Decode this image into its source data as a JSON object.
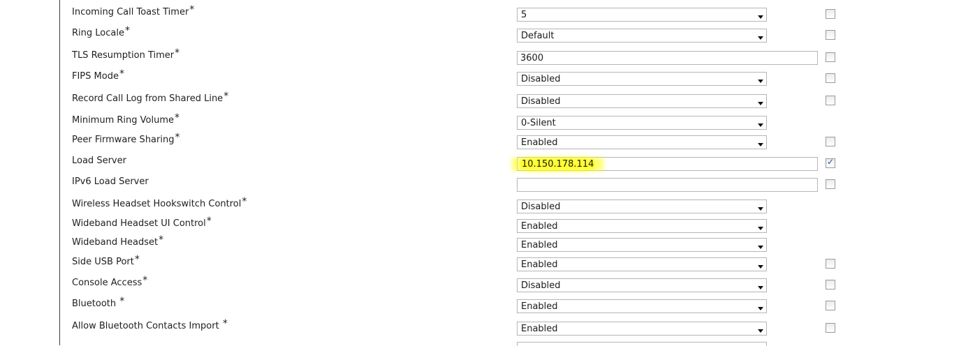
{
  "rows": [
    {
      "label": "Incoming Call Toast Timer",
      "required": "*",
      "control": "select",
      "value": "5",
      "checkbox": true,
      "checked": false
    },
    {
      "label": "Ring Locale",
      "required": "*",
      "control": "select",
      "value": "Default",
      "checkbox": true,
      "checked": false
    },
    {
      "label": "TLS Resumption Timer",
      "required": "*",
      "control": "text",
      "value": "3600",
      "checkbox": true,
      "checked": false
    },
    {
      "label": "FIPS Mode",
      "required": "*",
      "control": "select",
      "value": "Disabled",
      "checkbox": true,
      "checked": false
    },
    {
      "label": "Record Call Log from Shared Line",
      "required": "*",
      "control": "select",
      "value": "Disabled",
      "checkbox": true,
      "checked": false
    },
    {
      "label": "Minimum Ring Volume",
      "required": "*",
      "control": "select",
      "value": "0-Silent",
      "checkbox": false,
      "checked": false
    },
    {
      "label": "Peer Firmware Sharing",
      "required": "*",
      "control": "select",
      "value": "Enabled",
      "checkbox": true,
      "checked": false
    },
    {
      "label": "Load Server",
      "required": "",
      "control": "text",
      "value": "10.150.178.114",
      "checkbox": true,
      "checked": true,
      "highlight": true
    },
    {
      "label": "IPv6 Load Server",
      "required": "",
      "control": "text",
      "value": "",
      "checkbox": true,
      "checked": false
    },
    {
      "label": "Wireless Headset Hookswitch Control",
      "required": "*",
      "control": "select",
      "value": "Disabled",
      "checkbox": false,
      "checked": false
    },
    {
      "label": "Wideband Headset UI Control",
      "required": "*",
      "control": "select",
      "value": "Enabled",
      "checkbox": false,
      "checked": false
    },
    {
      "label": "Wideband Headset",
      "required": "*",
      "control": "select",
      "value": "Enabled",
      "checkbox": false,
      "checked": false
    },
    {
      "label": "Side USB Port",
      "required": "*",
      "control": "select",
      "value": "Enabled",
      "checkbox": true,
      "checked": false
    },
    {
      "label": "Console Access",
      "required": "*",
      "control": "select",
      "value": "Disabled",
      "checkbox": true,
      "checked": false
    },
    {
      "label": "Bluetooth ",
      "required": "*",
      "control": "select",
      "value": "Enabled",
      "checkbox": true,
      "checked": false
    },
    {
      "label": "Allow Bluetooth Contacts Import ",
      "required": "*",
      "control": "select",
      "value": "Enabled",
      "checkbox": true,
      "checked": false
    }
  ],
  "highlight_color": "#ffff33"
}
